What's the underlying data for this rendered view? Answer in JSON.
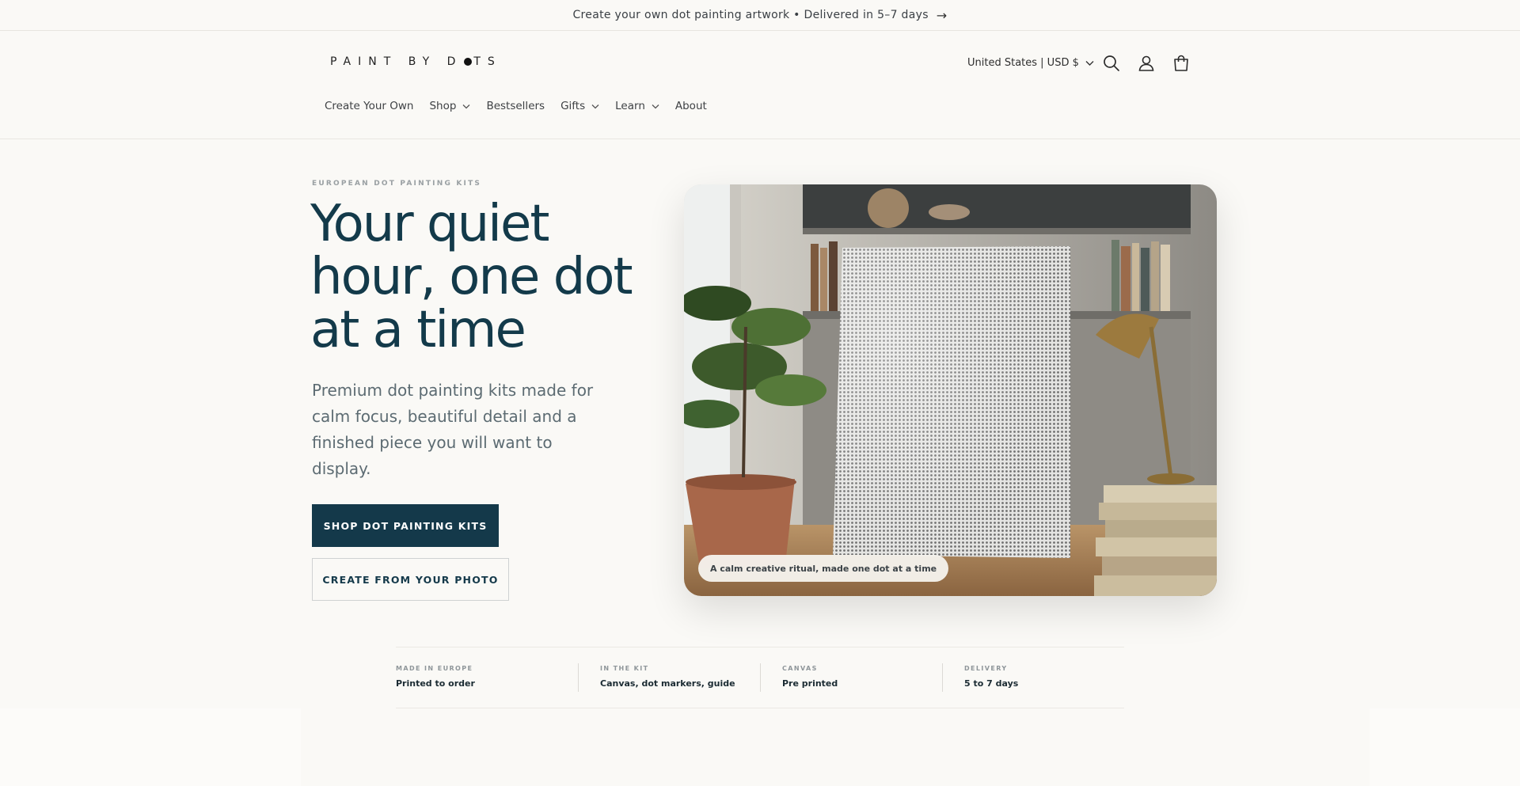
{
  "announcement": {
    "text": "Create your own dot painting artwork • Delivered in 5–7 days",
    "arrow_icon": "arrow-right-icon"
  },
  "header": {
    "logo_left": "PAINT BY D",
    "logo_right": "TS",
    "locale_selector": "United States | USD $",
    "icons": [
      "search-icon",
      "account-icon",
      "cart-icon"
    ]
  },
  "nav": {
    "items": [
      {
        "label": "Create Your Own",
        "has_dropdown": false
      },
      {
        "label": "Shop",
        "has_dropdown": true
      },
      {
        "label": "Bestsellers",
        "has_dropdown": false
      },
      {
        "label": "Gifts",
        "has_dropdown": true
      },
      {
        "label": "Learn",
        "has_dropdown": true
      },
      {
        "label": "About",
        "has_dropdown": false
      }
    ]
  },
  "hero": {
    "eyebrow": "EUROPEAN DOT PAINTING KITS",
    "headline": "Your quiet hour, one dot at a time",
    "subcopy": "Premium dot painting kits made for calm focus, beautiful detail and a finished piece you will want to display.",
    "primary_cta": "SHOP DOT PAINTING KITS",
    "secondary_cta": "CREATE FROM YOUR PHOTO",
    "image_caption": "A calm creative ritual, made one dot at a time"
  },
  "stats": [
    {
      "label": "MADE IN EUROPE",
      "value": "Printed to order"
    },
    {
      "label": "IN THE KIT",
      "value": "Canvas, dot markers, guide"
    },
    {
      "label": "CANVAS",
      "value": "Pre printed"
    },
    {
      "label": "DELIVERY",
      "value": "5 to 7 days"
    }
  ],
  "colors": {
    "background": "#faf9f6",
    "brand_dark": "#14394a",
    "headline": "#133a4a",
    "body_text": "#5c6b72"
  }
}
